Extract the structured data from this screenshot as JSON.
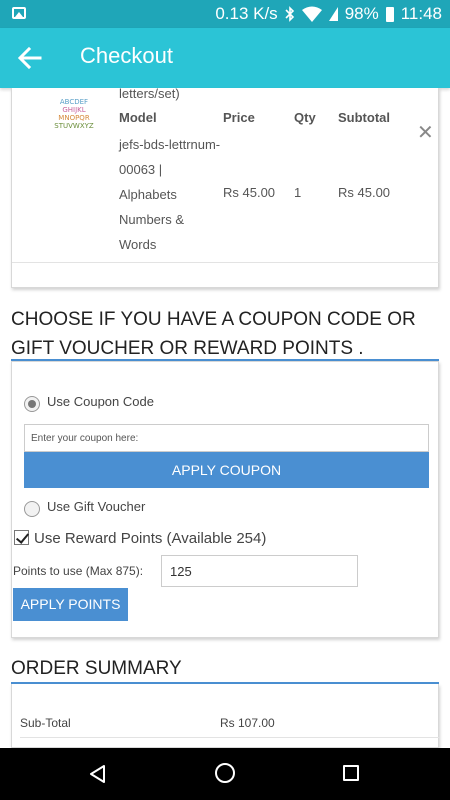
{
  "status_bar": {
    "speed": "0.13 K/s",
    "battery": "98%",
    "time": "11:48"
  },
  "app_bar": {
    "title": "Checkout"
  },
  "cart": {
    "headers": {
      "model": "Model",
      "price": "Price",
      "qty": "Qty",
      "subtotal": "Subtotal"
    },
    "item": {
      "name_tail": "letters/set)",
      "thumb_lines": [
        "ABCDEF",
        "GHIJKL",
        "MNOPQR",
        "STUVWXYZ"
      ],
      "model_lines": [
        "jefs-bds-lettrnum-",
        "00063 |",
        "Alphabets",
        "Numbers &",
        "Words"
      ],
      "price": "Rs 45.00",
      "qty": "1",
      "subtotal": "Rs 45.00"
    }
  },
  "coupon_section": {
    "title_line1": "CHOOSE IF YOU HAVE A COUPON CODE OR",
    "title_line2": "GIFT VOUCHER OR REWARD POINTS .",
    "use_coupon_label": "Use Coupon Code",
    "coupon_placeholder": "Enter your coupon here:",
    "apply_coupon_label": "APPLY COUPON",
    "use_gift_label": "Use Gift Voucher",
    "reward_label": "Use Reward Points (Available 254)",
    "points_label": "Points to use (Max 875):",
    "points_value": "125",
    "apply_points_label": "APPLY POINTS"
  },
  "order_summary": {
    "title": "ORDER SUMMARY",
    "rows": [
      {
        "label": "Sub-Total",
        "value": "Rs 107.00"
      }
    ]
  },
  "colors": {
    "status_bar": "#1fa6b8",
    "app_bar": "#2bc4d6",
    "accent_blue": "#4a8fd2"
  }
}
